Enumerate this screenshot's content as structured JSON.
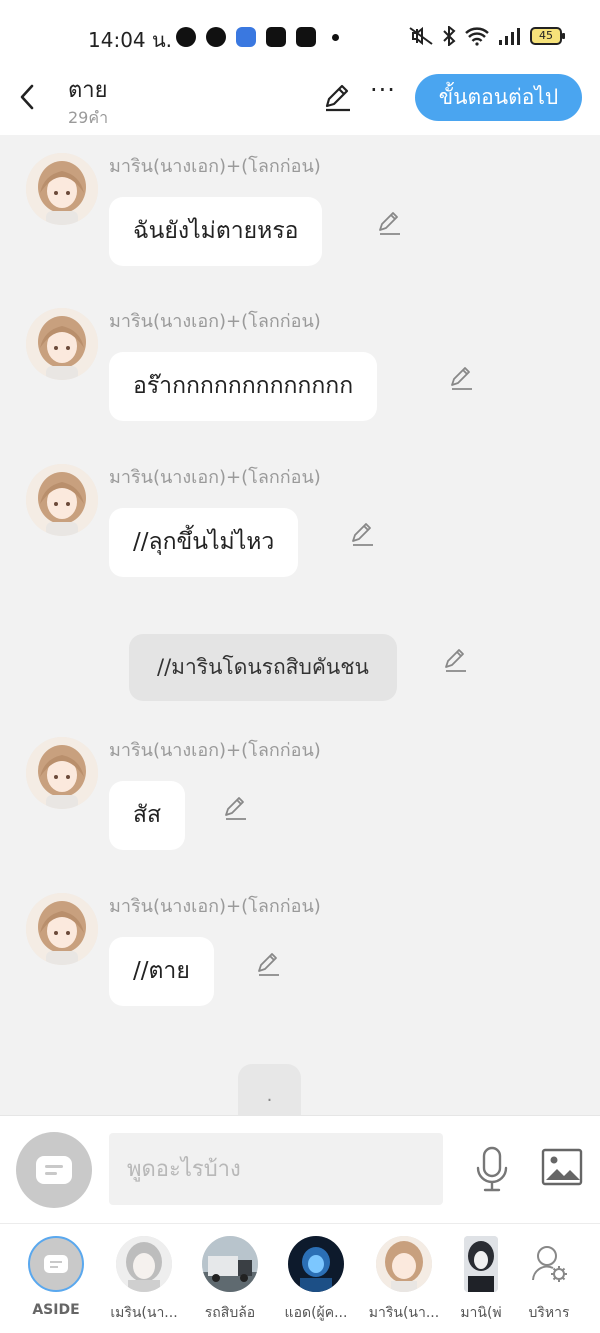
{
  "status_bar": {
    "time": "14:04 น.",
    "battery": "45",
    "app_icons": [
      "line-icon",
      "messenger-icon",
      "blue-app-icon",
      "shopee-icon",
      "facebook-icon"
    ],
    "system_icons": [
      "mute-icon",
      "bluetooth-icon",
      "wifi-icon",
      "signal-icon",
      "battery-icon"
    ]
  },
  "header": {
    "title": "ตาย",
    "subtitle": "29คำ",
    "next_button": "ขั้นตอนต่อไป",
    "more_label": "···"
  },
  "messages": [
    {
      "sender": "มาริน(นางเอก)+(โลกก่อน)",
      "text": "ฉันยังไม่ตายหรอ"
    },
    {
      "sender": "มาริน(นางเอก)+(โลกก่อน)",
      "text": "อร๊ากกกกกกกกกกกกก"
    },
    {
      "sender": "มาริน(นางเอก)+(โลกก่อน)",
      "text": "//ลุกขึ้นไม่ไหว"
    },
    {
      "sender": "มาริน(นางเอก)+(โลกก่อน)",
      "text": "สัส"
    },
    {
      "sender": "มาริน(นางเอก)+(โลกก่อน)",
      "text": "//ตาย"
    }
  ],
  "narration": {
    "text": "//มารินโดนรถสิบคันชน"
  },
  "typing_indicator": ".",
  "input": {
    "placeholder": "พูดอะไรบ้าง",
    "value": ""
  },
  "characters": [
    {
      "label": "ASIDE"
    },
    {
      "label": "เมริน(นา..."
    },
    {
      "label": "รถสิบล้อ"
    },
    {
      "label": "แอด(ผู้ค..."
    },
    {
      "label": "มาริน(นา..."
    },
    {
      "label": "มานิ(พ่"
    },
    {
      "label": "บริหาร"
    }
  ],
  "colors": {
    "accent": "#4aa5f0",
    "chat_background": "#f2f2f2",
    "bubble": "#ffffff",
    "narration_bubble": "#e4e4e4",
    "muted_text": "#9a9a9a"
  }
}
